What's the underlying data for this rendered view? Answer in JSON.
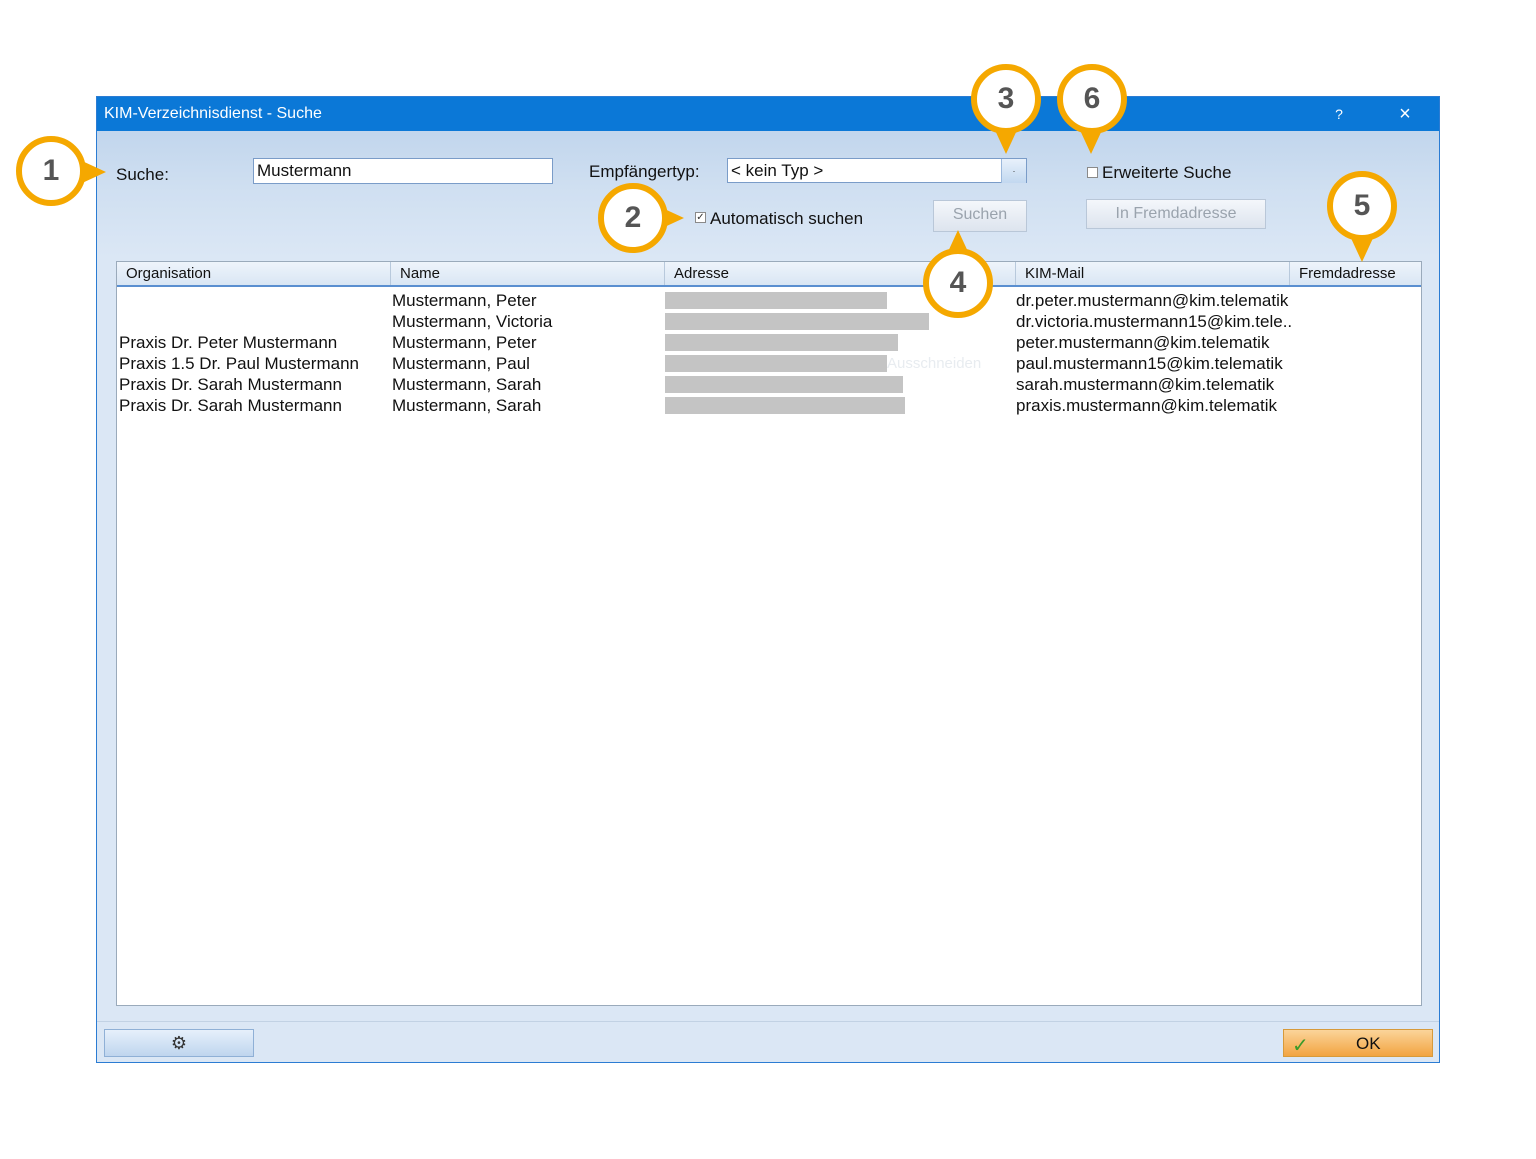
{
  "window": {
    "title": "KIM-Verzeichnisdienst - Suche",
    "help": "?",
    "close": "×"
  },
  "search": {
    "label": "Suche:",
    "value": "Mustermann"
  },
  "recipient_type": {
    "label": "Empfängertyp:",
    "value": "< kein Typ >",
    "arrow": "·"
  },
  "extended_search": {
    "label": "Erweiterte Suche",
    "checked": false
  },
  "auto_search": {
    "label": "Automatisch suchen",
    "checked": true,
    "mark": "✓"
  },
  "buttons": {
    "search": "Suchen",
    "to_foreign": "In Fremdadresse",
    "ok": "OK",
    "ok_icon": "✓",
    "settings_icon": "⚙"
  },
  "table": {
    "columns": [
      "Organisation",
      "Name",
      "Adresse",
      "KIM-Mail",
      "Fremdadresse"
    ],
    "rows": [
      {
        "organisation": "",
        "name": "Mustermann, Peter",
        "kim_mail": "dr.peter.mustermann@kim.telematik"
      },
      {
        "organisation": "",
        "name": "Mustermann, Victoria",
        "kim_mail": "dr.victoria.mustermann15@kim.tele.."
      },
      {
        "organisation": "Praxis Dr. Peter Mustermann",
        "name": "Mustermann, Peter",
        "kim_mail": "peter.mustermann@kim.telematik"
      },
      {
        "organisation": "Praxis 1.5 Dr. Paul Mustermann",
        "name": "Mustermann, Paul",
        "kim_mail": "paul.mustermann15@kim.telematik"
      },
      {
        "organisation": "Praxis Dr. Sarah Mustermann",
        "name": "Mustermann, Sarah",
        "kim_mail": "sarah.mustermann@kim.telematik"
      },
      {
        "organisation": "Praxis Dr. Sarah Mustermann",
        "name": "Mustermann, Sarah",
        "kim_mail": "praxis.mustermann@kim.telematik"
      }
    ],
    "ghost_text": "Ausschneiden"
  },
  "callouts": [
    "1",
    "2",
    "3",
    "4",
    "5",
    "6"
  ],
  "colors": {
    "titlebar": "#0b78d7",
    "callout_ring": "#f5a800",
    "ok_button": "#f2a441"
  }
}
